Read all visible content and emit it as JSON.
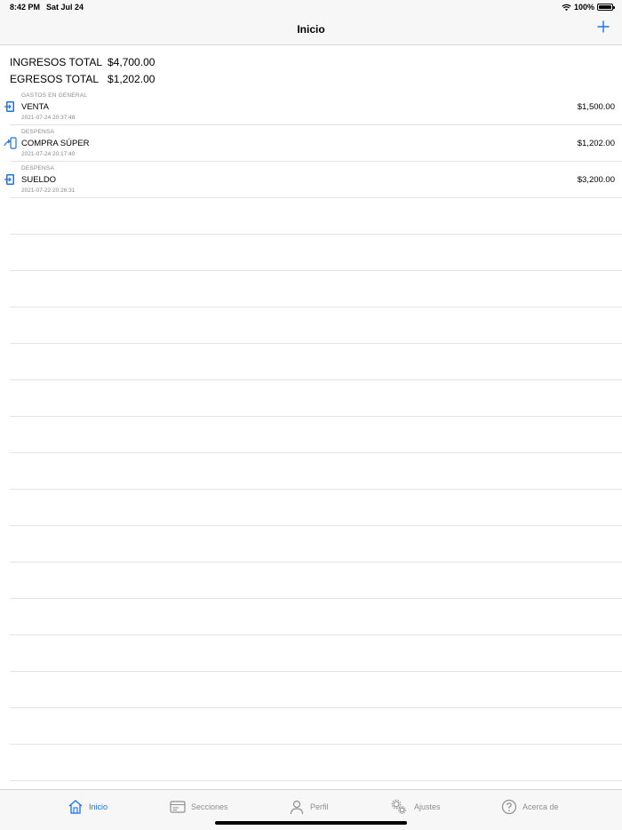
{
  "status_bar": {
    "time": "8:42 PM",
    "date": "Sat Jul 24",
    "battery": "100%"
  },
  "nav": {
    "title": "Inicio"
  },
  "totals": {
    "income_label": "INGRESOS TOTAL",
    "income_value": "$4,700.00",
    "expense_label": "EGRESOS TOTAL",
    "expense_value": "$1,202.00"
  },
  "transactions": [
    {
      "section": "GASTOS EN GENERAL",
      "name": "VENTA",
      "timestamp": "2021-07-24 20:37:48",
      "amount": "$1,500.00",
      "icon": "income-icon"
    },
    {
      "section": "DESPENSA",
      "name": "COMPRA SÚPER",
      "timestamp": "2021-07-24 20:17:40",
      "amount": "$1,202.00",
      "icon": "expense-icon"
    },
    {
      "section": "DESPENSA",
      "name": "SUELDO",
      "timestamp": "2021-07-22 20:26:31",
      "amount": "$3,200.00",
      "icon": "income-icon"
    }
  ],
  "tabs": [
    {
      "label": "Inicio",
      "icon": "house-icon",
      "active": true
    },
    {
      "label": "Secciones",
      "icon": "card-icon",
      "active": false
    },
    {
      "label": "Perfil",
      "icon": "person-icon",
      "active": false
    },
    {
      "label": "Ajustes",
      "icon": "gears-icon",
      "active": false
    },
    {
      "label": "Acerca de",
      "icon": "question-icon",
      "active": false
    }
  ],
  "colors": {
    "accent": "#1a73e8",
    "secondary_text": "#8a8a8a",
    "separator": "#e3e3e3"
  }
}
